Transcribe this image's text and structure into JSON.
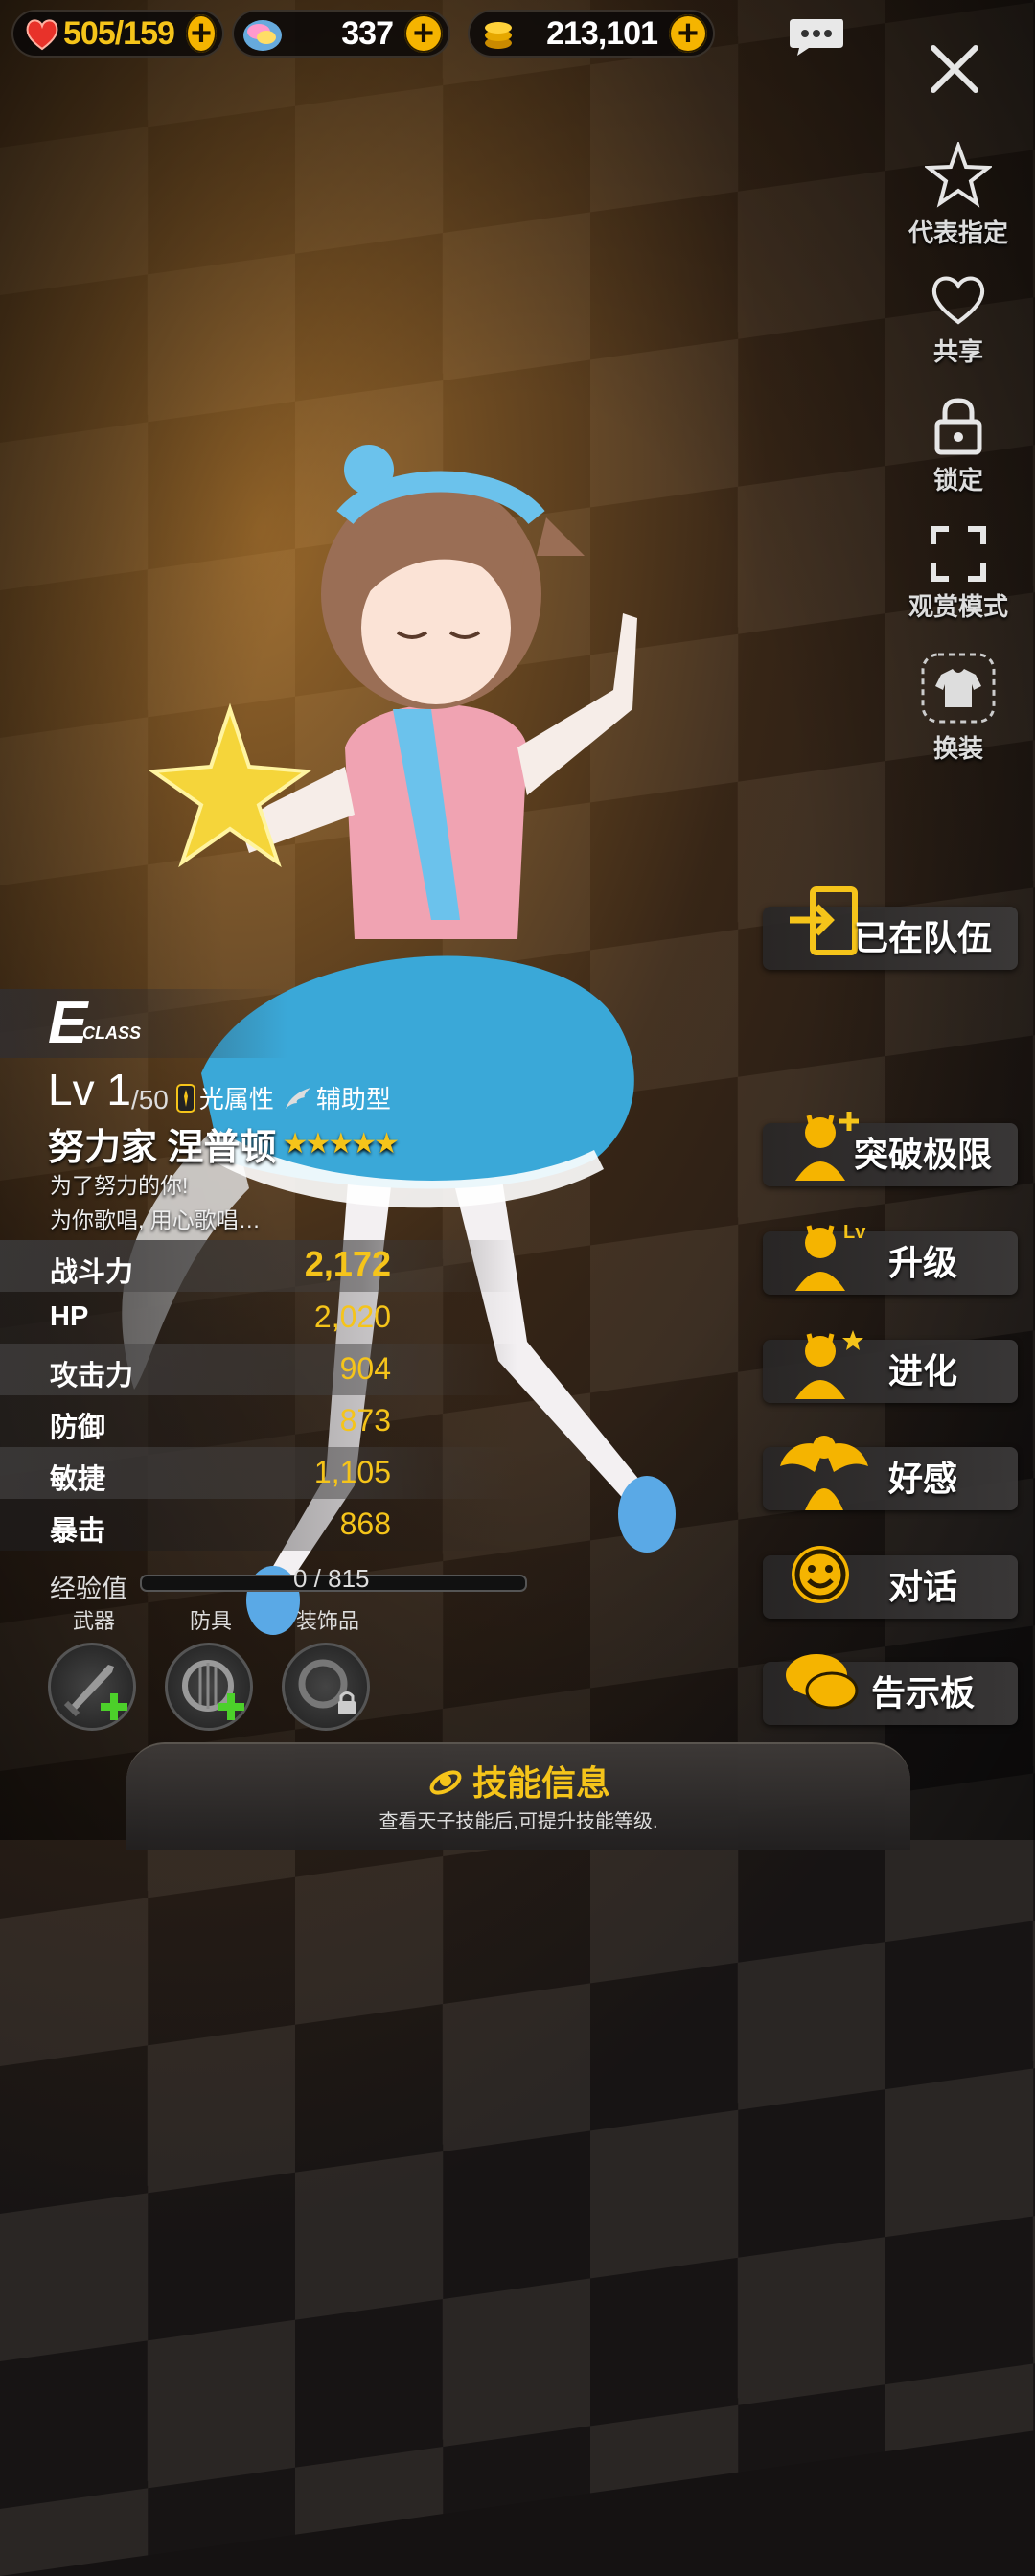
{
  "resources": {
    "stamina": {
      "icon": "heart-icon",
      "value": "505/159"
    },
    "gems": {
      "icon": "rainbow-gem-icon",
      "value": "337"
    },
    "gold": {
      "icon": "gold-coin-icon",
      "value": "213,101"
    }
  },
  "side_menu": [
    {
      "id": "representative",
      "icon": "star-icon",
      "label": "代表指定"
    },
    {
      "id": "share",
      "icon": "heart-outline-icon",
      "label": "共享"
    },
    {
      "id": "lock",
      "icon": "lock-icon",
      "label": "锁定"
    },
    {
      "id": "view",
      "icon": "fullscreen-icon",
      "label": "观赏模式"
    },
    {
      "id": "costume",
      "icon": "shirt-icon",
      "label": "换装"
    }
  ],
  "actions": {
    "in_team": "已在队伍",
    "limit_break": "突破极限",
    "level_up": "升级",
    "level_up_badge": "Lv",
    "evolve": "进化",
    "affection": "好感",
    "talk": "对话",
    "board": "告示板"
  },
  "character": {
    "class_letter": "E",
    "class_word": "CLASS",
    "level": "Lv 1",
    "level_max": "/50",
    "attribute": "光属性",
    "role": "辅助型",
    "name": "努力家 涅普顿",
    "stars": 5,
    "stars_text": "★★★★★",
    "quote_line1": "为了努力的你!",
    "quote_line2": "为你歌唱, 用心歌唱…"
  },
  "stats": [
    {
      "label": "战斗力",
      "value": "2,172"
    },
    {
      "label": "HP",
      "value": "2,020"
    },
    {
      "label": "攻击力",
      "value": "904"
    },
    {
      "label": "防御",
      "value": "873"
    },
    {
      "label": "敏捷",
      "value": "1,105"
    },
    {
      "label": "暴击",
      "value": "868"
    }
  ],
  "exp": {
    "label": "经验值",
    "value": "0 / 815",
    "progress": 0
  },
  "equipment": {
    "weapon": "武器",
    "armor": "防具",
    "accessory": "装饰品"
  },
  "skill": {
    "title": "技能信息",
    "subtitle": "查看天子技能后,可提升技能等级."
  },
  "colors": {
    "accent": "#f5c41a",
    "plus": "#f5b400"
  }
}
